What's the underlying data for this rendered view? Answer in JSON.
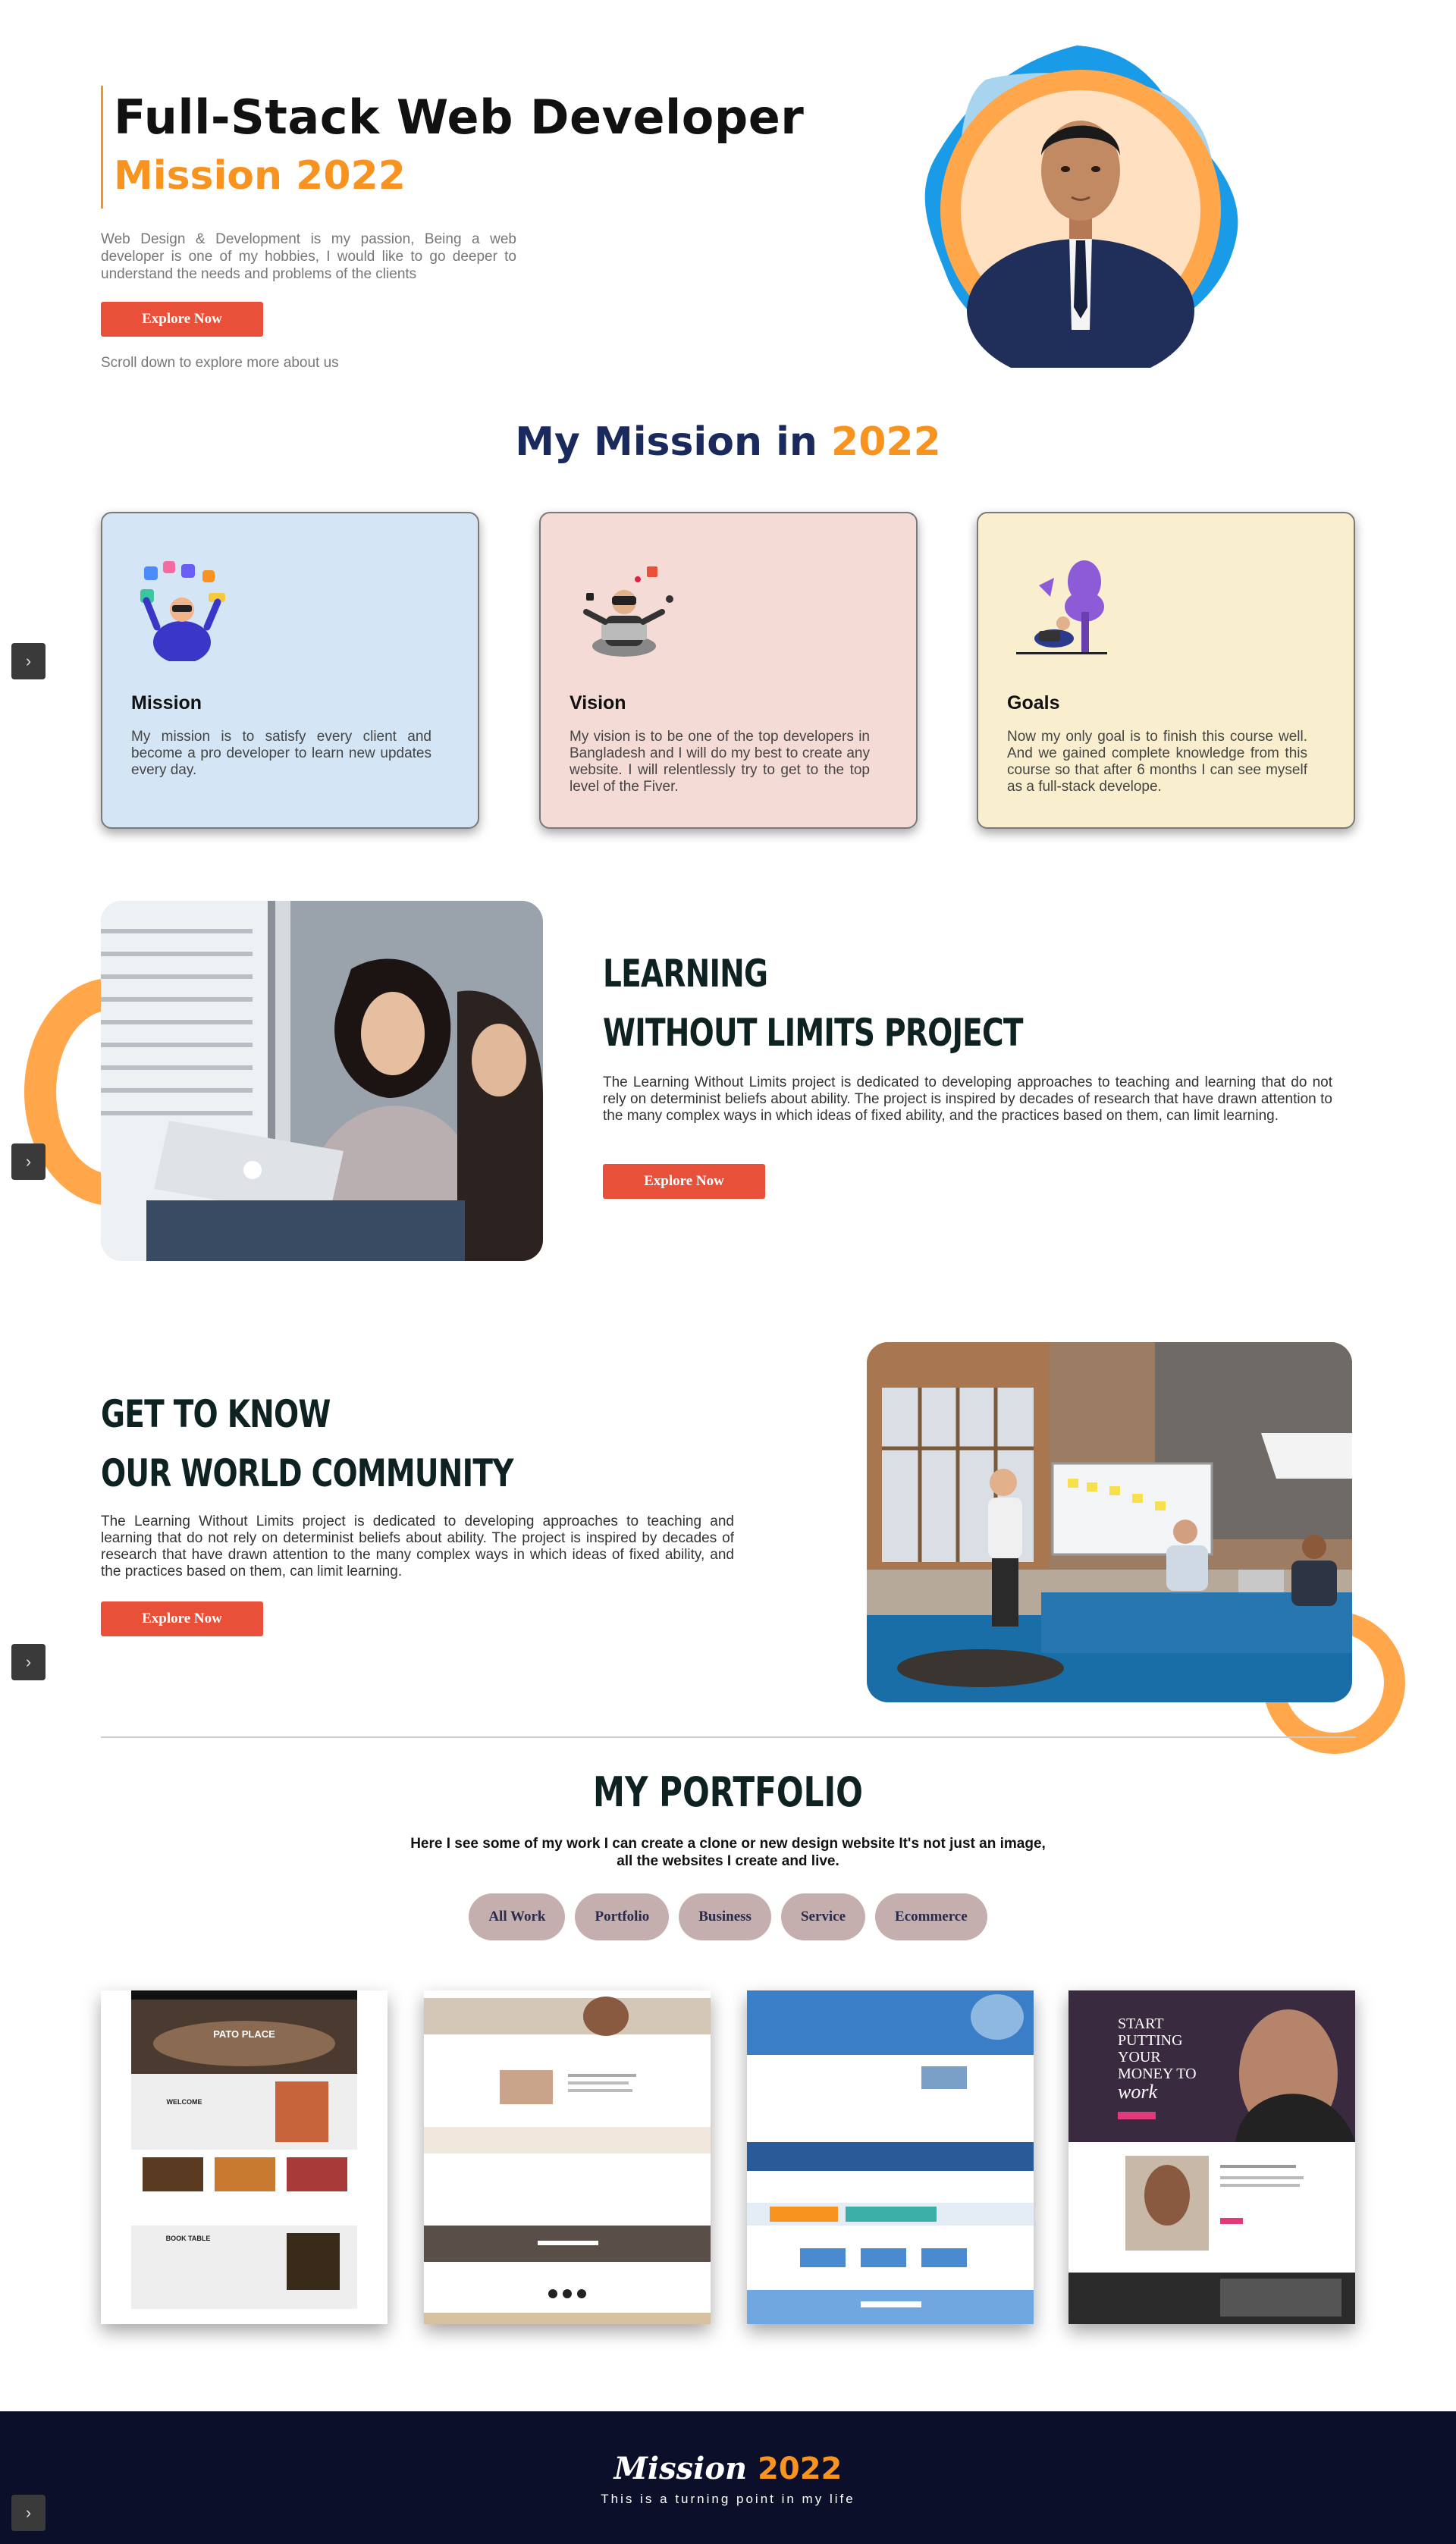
{
  "hero": {
    "title": "Full-Stack Web Developer",
    "subtitle": "Mission 2022",
    "description": "Web Design & Development is my passion, Being a web developer is one of my hobbies, I would like to go deeper to understand the needs and problems of the clients",
    "button_label": "Explore Now",
    "scroll_hint": "Scroll down to explore more about us"
  },
  "mission_section": {
    "title_main": "My Mission in",
    "title_accent": "2022",
    "cards": [
      {
        "title": "Mission",
        "text": "My mission is to satisfy every client and become a pro developer to learn new updates every day.",
        "bg": "#d4e6f5"
      },
      {
        "title": "Vision",
        "text": "My vision is to be one of the top developers in Bangladesh and I will do my best to create any website. I will relentlessly try to get to the top level of the Fiver.",
        "bg": "#f4dbd6"
      },
      {
        "title": "Goals",
        "text": "Now my only goal is to finish this course well. And we gained complete knowledge from this course so that after 6 months I can see myself as a full-stack develope.",
        "bg": "#f9efcf"
      }
    ]
  },
  "learning": {
    "heading_line1": "LEARNING",
    "heading_line2": "WITHOUT LIMITS PROJECT",
    "text": "The Learning Without Limits project is dedicated to developing approaches to teaching and learning that do not rely on determinist beliefs about ability. The project is inspired by decades of research that have drawn attention to the many complex ways in which ideas of fixed ability, and the practices based on them, can limit learning.",
    "button_label": "Explore Now"
  },
  "community": {
    "heading_line1": "GET TO KNOW",
    "heading_line2": "OUR WORLD COMMUNITY",
    "text": "The Learning Without Limits project is dedicated to developing approaches to teaching and learning that do not rely on determinist beliefs about ability. The project is inspired by decades of research that have drawn attention to the many complex ways in which ideas of fixed ability, and the practices based on them, can limit learning.",
    "button_label": "Explore Now"
  },
  "portfolio": {
    "title": "MY PORTFOLIO",
    "description": "Here I see some of my work I can create a clone or new design website It's not just an image, all the websites I create and live.",
    "filters": [
      "All Work",
      "Portfolio",
      "Business",
      "Service",
      "Ecommerce"
    ],
    "thumbs": {
      "t1_title": "PATO PLACE",
      "t1_welcome": "WELCOME",
      "t1_book": "BOOK TABLE",
      "t4_line1": "START",
      "t4_line2": "PUTTING",
      "t4_line3": "YOUR",
      "t4_line4": "MONEY TO",
      "t4_line5": "work"
    }
  },
  "footer": {
    "logo_main": "Mission",
    "logo_accent": "2022",
    "tagline": "This is a turning point in my life"
  },
  "icons": {
    "side_arrow": "chevron-right-icon"
  },
  "colors": {
    "accent": "#f7931e",
    "button": "#e8503a",
    "navy": "#1a2a5c",
    "footer": "#0b0f2a"
  }
}
